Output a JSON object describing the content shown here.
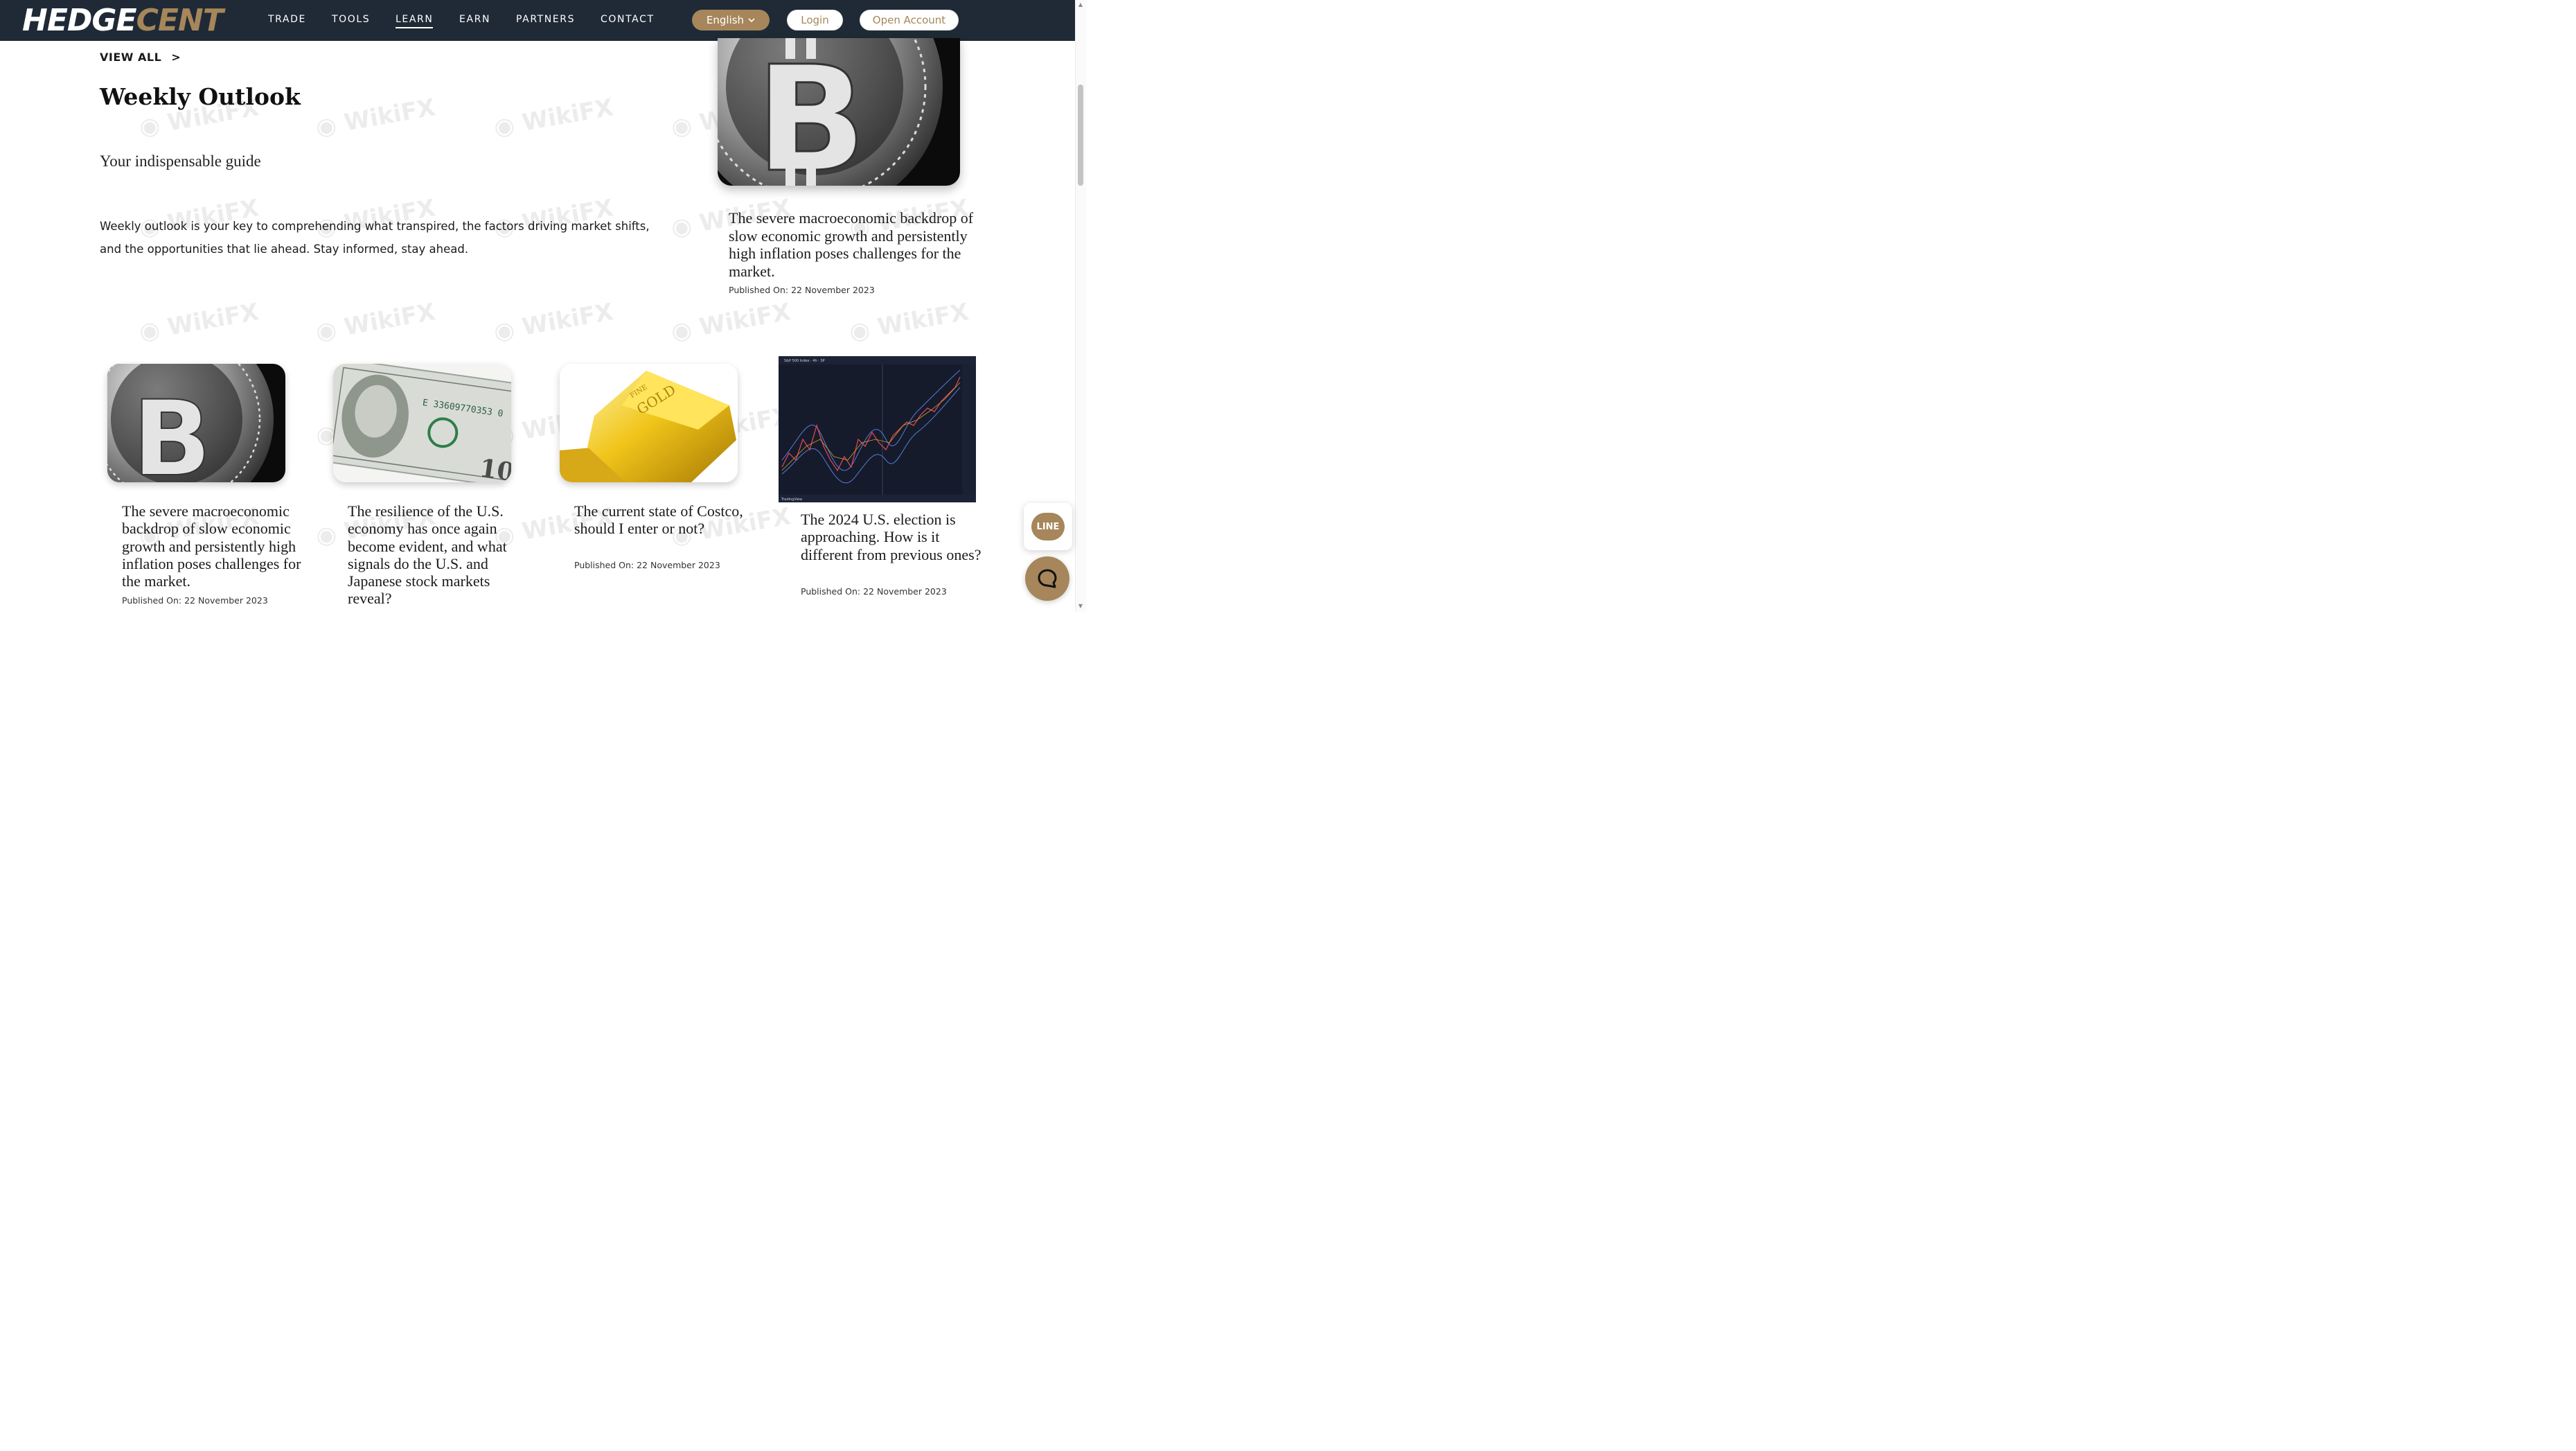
{
  "header": {
    "logo_text": "HEDGECENT",
    "nav": [
      {
        "label": "TRADE"
      },
      {
        "label": "TOOLS"
      },
      {
        "label": "LEARN"
      },
      {
        "label": "EARN"
      },
      {
        "label": "PARTNERS"
      },
      {
        "label": "CONTACT"
      }
    ],
    "active_nav": "LEARN",
    "language": "English",
    "login_label": "Login",
    "open_account_label": "Open Account"
  },
  "hero": {
    "view_all": "VIEW ALL",
    "view_all_chevron": ">",
    "title": "Weekly Outlook",
    "subtitle": "Your indispensable guide",
    "description": "Weekly outlook is your key to comprehending what transpired, the factors driving market shifts, and the opportunities that lie ahead. Stay informed, stay ahead."
  },
  "featured": {
    "image": "bitcoin-coin",
    "title": "The severe macroeconomic backdrop of slow economic growth and persistently high inflation poses challenges for the market.",
    "date": "Published On: 22 November 2023"
  },
  "articles": [
    {
      "image": "bitcoin-coin",
      "title": "The severe macroeconomic backdrop of slow economic growth and persistently high inflation poses challenges for the market.",
      "date": "Published On: 22 November 2023"
    },
    {
      "image": "hundred-dollar-bills",
      "title": "The resilience of the U.S. economy has once again become evident, and what signals do the U.S. and Japanese stock markets reveal?",
      "date": ""
    },
    {
      "image": "gold-bars",
      "title": "The current state of Costco, should I enter or not?",
      "date": "Published On: 22 November 2023"
    },
    {
      "image": "sp500-chart",
      "title": "The 2024 U.S. election is approaching. How is it different from previous ones?",
      "date": "Published On: 22 November 2023"
    }
  ],
  "chart_image": {
    "header_text": "S&P 500 Index · 4h · SP",
    "footer_text": "TradingView"
  },
  "widgets": {
    "line_label": "LINE"
  },
  "watermark_text": "WikiFX",
  "colors": {
    "header_bg": "#1f2a36",
    "accent_gold": "#a6865a",
    "text": "#1a1a1a"
  }
}
